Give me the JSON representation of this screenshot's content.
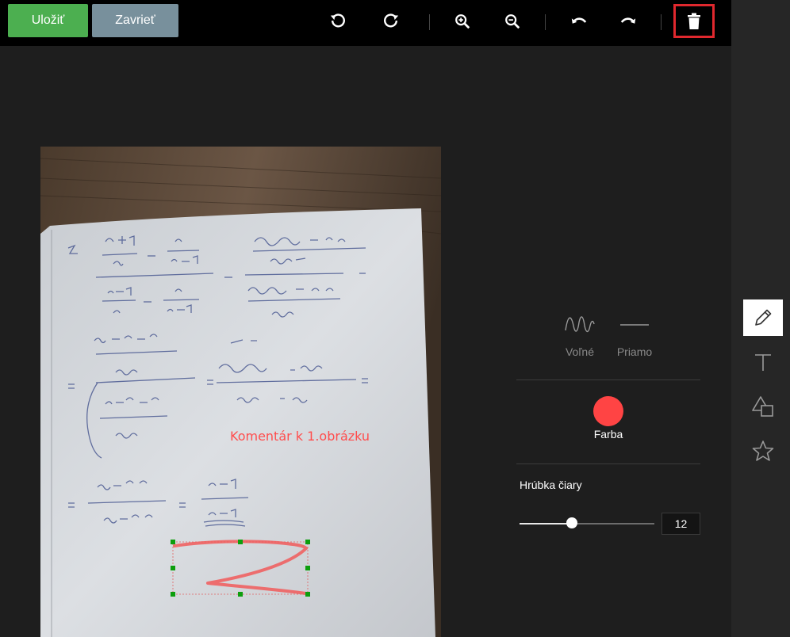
{
  "toolbar": {
    "save_label": "Uložiť",
    "close_label": "Zavrieť"
  },
  "canvas": {
    "annotation_text": "Komentár k 1.obrázku"
  },
  "draw_panel": {
    "modes": [
      {
        "label": "Voľné",
        "icon": "freehand-wave-icon"
      },
      {
        "label": "Priamo",
        "icon": "straight-line-icon"
      }
    ],
    "color_label": "Farba",
    "color": "#ff4444",
    "thickness_label": "Hrúbka čiary",
    "thickness_value": "12",
    "slider_fraction": 0.39
  },
  "colors": {
    "save": "#4caf50",
    "close": "#78909c",
    "highlight": "#e0282e"
  }
}
